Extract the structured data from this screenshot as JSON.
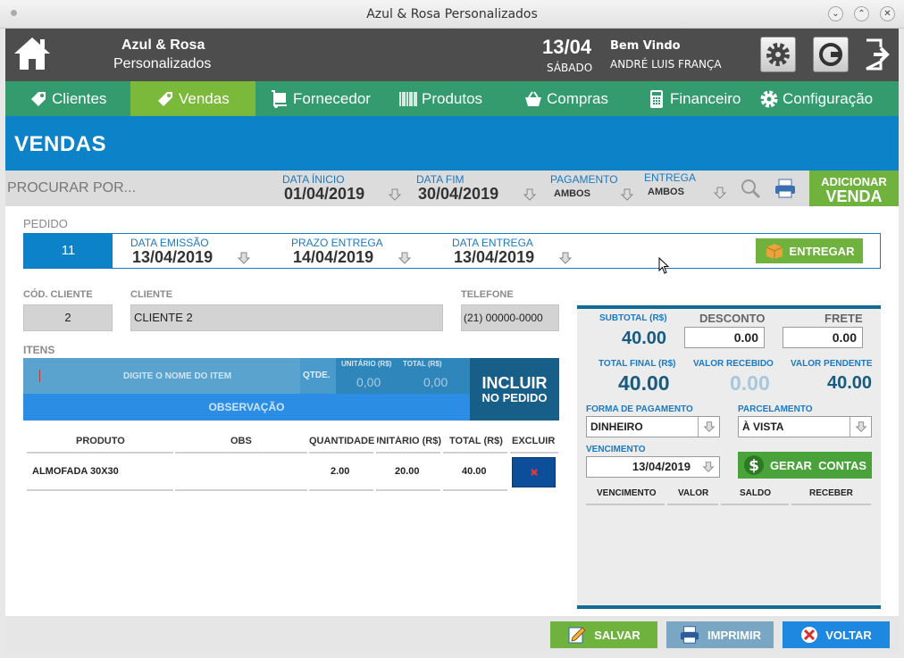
{
  "window": {
    "title": "Azul & Rosa Personalizados"
  },
  "header": {
    "company_line1": "Azul & Rosa",
    "company_line2": "Personalizados",
    "date": "13/04",
    "weekday": "SÁBADO",
    "welcome": "Bem Vindo",
    "user": "ANDRÉ LUIS FRANÇA"
  },
  "nav": {
    "items": [
      {
        "label": "Clientes"
      },
      {
        "label": "Vendas"
      },
      {
        "label": "Fornecedor"
      },
      {
        "label": "Produtos"
      },
      {
        "label": "Compras"
      },
      {
        "label": "Financeiro"
      },
      {
        "label": "Configuração"
      }
    ],
    "active_color": "#7ab93a",
    "bar_color": "#339b6e"
  },
  "page": {
    "title": "VENDAS"
  },
  "filter": {
    "search_placeholder": "PROCURAR POR...",
    "start_label": "DATA ÍNICIO",
    "start_value": "01/04/2019",
    "end_label": "DATA FIM",
    "end_value": "30/04/2019",
    "payment_label": "PAGAMENTO",
    "payment_value": "AMBOS",
    "delivery_label": "ENTREGA",
    "delivery_value": "AMBOS",
    "add_line1": "ADICIONAR",
    "add_line2": "VENDA"
  },
  "order": {
    "section_label": "PEDIDO",
    "number": "11",
    "issue_label": "DATA EMISSÃO",
    "issue_value": "13/04/2019",
    "deadline_label": "PRAZO ENTREGA",
    "deadline_value": "14/04/2019",
    "delivery_label": "DATA ENTREGA",
    "delivery_value": "13/04/2019",
    "deliver_button": "ENTREGAR"
  },
  "client": {
    "code_label": "CÓD. CLIENTE",
    "code_value": "2",
    "name_label": "CLIENTE",
    "name_value": "CLIENTE 2",
    "phone_label": "TELEFONE",
    "phone_value": "(21) 00000-0000"
  },
  "items_entry": {
    "section_label": "ITENS",
    "item_placeholder": "DIGITE O NOME  DO ITEM",
    "qty_label": "QTDE.",
    "unit_label": "UNITÁRIO (R$)",
    "total_label": "TOTAL (R$)",
    "unit_value": "0,00",
    "total_value": "0,00",
    "obs_placeholder": "OBSERVAÇÃO",
    "include_line1": "INCLUIR",
    "include_line2": "NO PEDIDO"
  },
  "items_table": {
    "headers": [
      "PRODUTO",
      "OBS",
      "QUANTIDADE",
      "UNITÁRIO (R$)",
      "TOTAL (R$)",
      "EXCLUIR"
    ],
    "rows": [
      {
        "product": "ALMOFADA 30X30",
        "obs": "",
        "qty": "2.00",
        "unit": "20.00",
        "total": "40.00"
      }
    ]
  },
  "summary": {
    "subtotal_label": "SUBTOTAL (R$)",
    "subtotal_value": "40.00",
    "discount_label": "DESCONTO",
    "discount_value": "0.00",
    "freight_label": "FRETE",
    "freight_value": "0.00",
    "final_label": "TOTAL FINAL (R$)",
    "final_value": "40.00",
    "received_label": "VALOR RECEBIDO",
    "received_value": "0.00",
    "pending_label": "VALOR PENDENTE",
    "pending_value": "40.00",
    "payment_label": "FORMA DE PAGAMENTO",
    "payment_value": "DINHEIRO",
    "installment_label": "PARCELAMENTO",
    "installment_value": "À VISTA",
    "due_label": "VENCIMENTO",
    "due_value": "13/04/2019",
    "generate_button": "GERAR  CONTAS",
    "columns": [
      "VENCIMENTO",
      "VALOR",
      "SALDO",
      "RECEBER"
    ]
  },
  "footer": {
    "save": "SALVAR",
    "print": "IMPRIMIR",
    "back": "VOLTAR"
  }
}
